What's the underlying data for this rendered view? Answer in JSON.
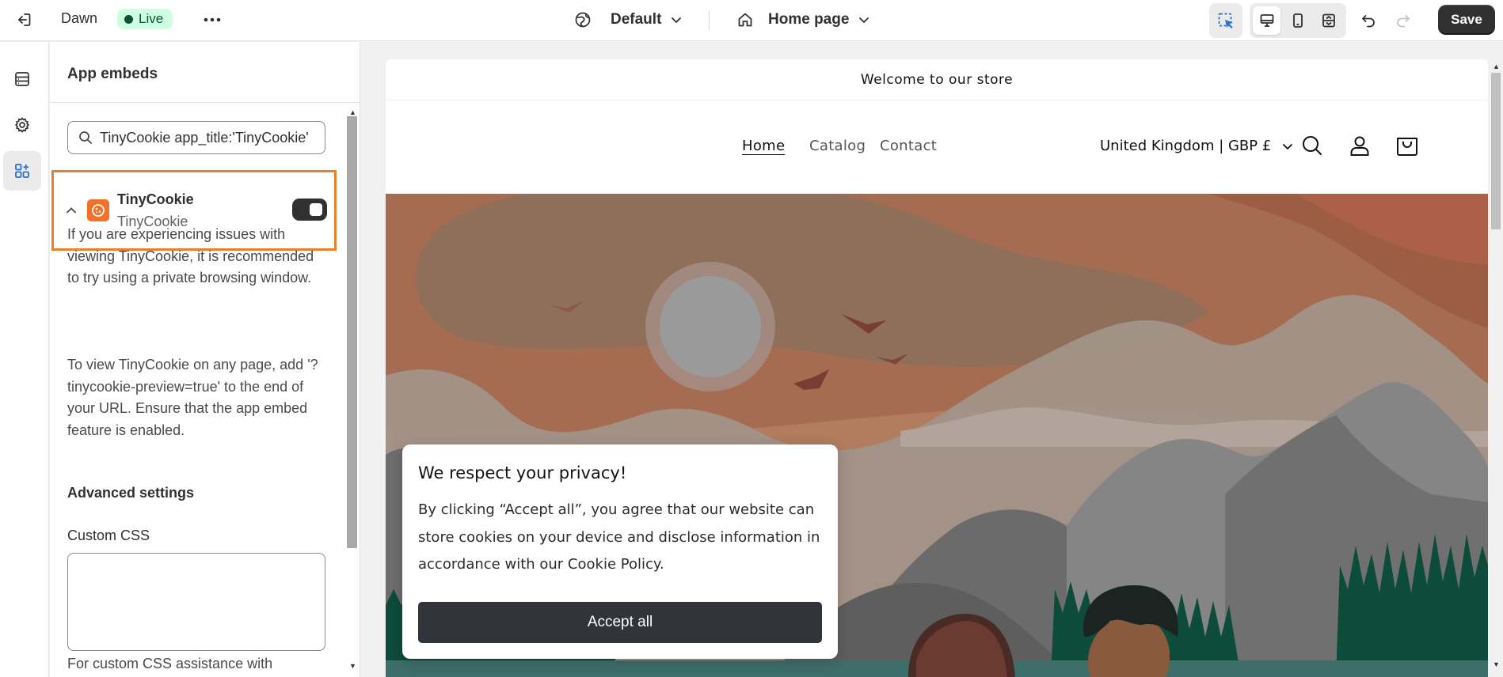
{
  "topbar": {
    "theme_name": "Dawn",
    "status_badge": "Live",
    "theme_select": "Default",
    "page_select": "Home page",
    "save_label": "Save"
  },
  "panel": {
    "title": "App embeds",
    "search": {
      "value": "TinyCookie app_title:'TinyCookie'"
    },
    "embed": {
      "name": "TinyCookie",
      "subtitle": "TinyCookie",
      "enabled": true
    },
    "info_paragraph_1": "If you are experiencing issues with viewing TinyCookie, it is recommended to try using a private browsing window.",
    "info_paragraph_2": "To view TinyCookie on any page, add '?tinycookie-preview=true' to the end of your URL. Ensure that the app embed feature is enabled.",
    "advanced_title": "Advanced settings",
    "custom_css_label": "Custom CSS",
    "custom_css_help": "For custom CSS assistance with"
  },
  "preview": {
    "announcement": "Welcome to our store",
    "nav": [
      "Home",
      "Catalog",
      "Contact"
    ],
    "country_selector": "United Kingdom | GBP £",
    "cookie_banner": {
      "title": "We respect your privacy!",
      "body": "By clicking “Accept all”, you agree that our website can store cookies on your device and disclose information in accordance with our Cookie Policy.",
      "button": "Accept all"
    }
  },
  "colors": {
    "accent_orange": "#e8802e",
    "live_badge_bg": "#cdfee1",
    "save_button": "#303030",
    "cookie_button": "#31343a",
    "hero_sky": "#b27c5e"
  },
  "icons": [
    "exit-icon",
    "more-icon",
    "globe-icon",
    "home-icon",
    "chevron-down-icon",
    "inspect-icon",
    "desktop-icon",
    "mobile-icon",
    "fullwidth-icon",
    "undo-icon",
    "redo-icon",
    "sections-icon",
    "settings-icon",
    "app-embeds-icon",
    "search-icon",
    "chevron-up-icon",
    "account-icon",
    "cart-icon"
  ]
}
